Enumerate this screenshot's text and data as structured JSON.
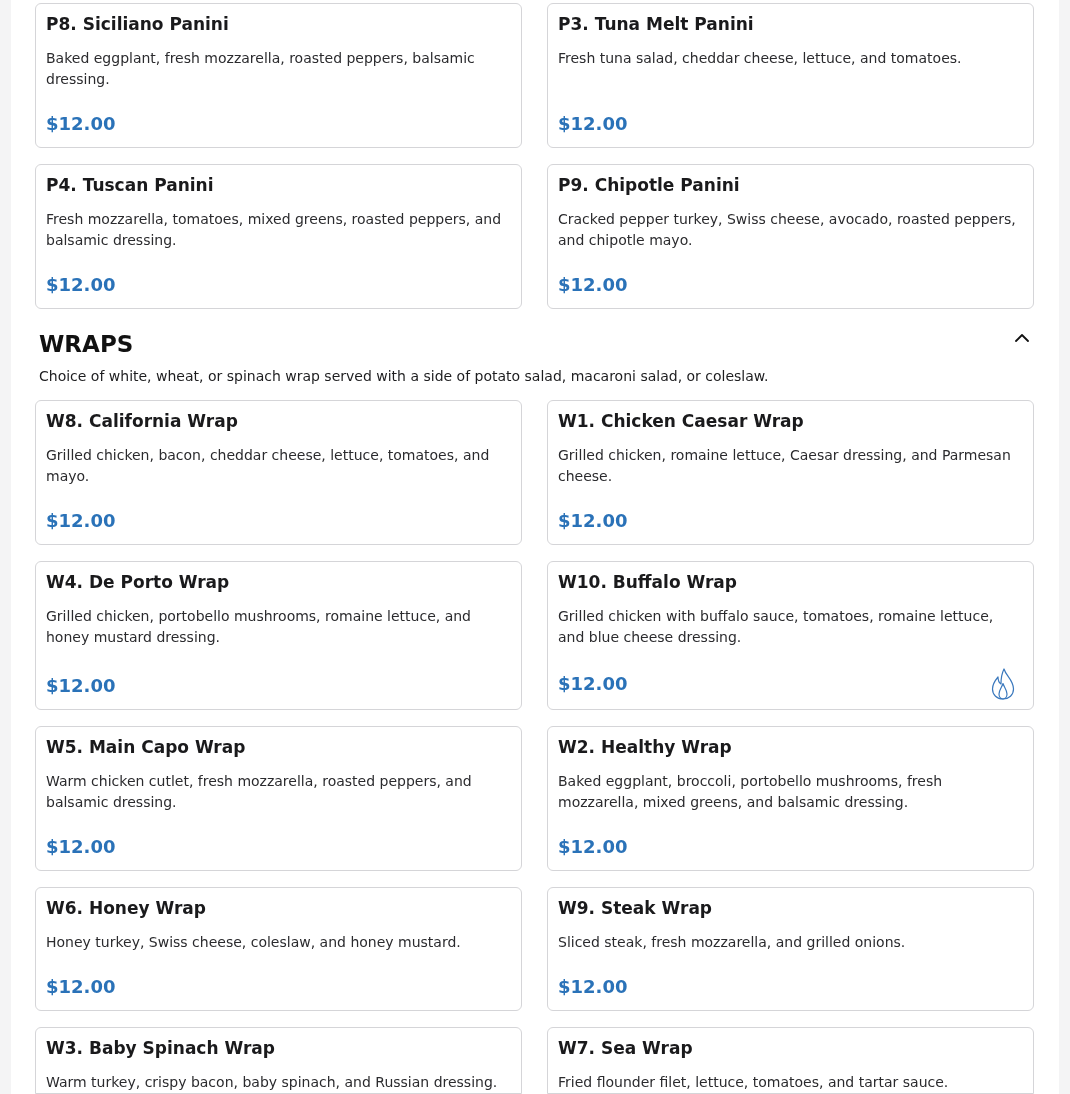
{
  "sections": [
    {
      "items": [
        {
          "title": "P8. Siciliano Panini",
          "description": "Baked eggplant, fresh mozzarella, roasted peppers, balsamic dressing.",
          "price": "$12.00",
          "spicy": false
        },
        {
          "title": "P3. Tuna Melt Panini",
          "description": "Fresh tuna salad, cheddar cheese, lettuce, and tomatoes.",
          "price": "$12.00",
          "spicy": false
        },
        {
          "title": "P4. Tuscan Panini",
          "description": "Fresh mozzarella, tomatoes, mixed greens, roasted peppers, and balsamic dressing.",
          "price": "$12.00",
          "spicy": false
        },
        {
          "title": "P9. Chipotle Panini",
          "description": "Cracked pepper turkey, Swiss cheese, avocado, roasted peppers, and chipotle mayo.",
          "price": "$12.00",
          "spicy": false
        }
      ]
    },
    {
      "title": "WRAPS",
      "expanded": true,
      "description": "Choice of white, wheat, or spinach wrap served with a side of potato salad, macaroni salad, or coleslaw.",
      "items": [
        {
          "title": "W8. California Wrap",
          "description": "Grilled chicken, bacon, cheddar cheese, lettuce, tomatoes, and mayo.",
          "price": "$12.00",
          "spicy": false
        },
        {
          "title": "W1. Chicken Caesar Wrap",
          "description": "Grilled chicken, romaine lettuce, Caesar dressing, and Parmesan cheese.",
          "price": "$12.00",
          "spicy": false
        },
        {
          "title": "W4. De Porto Wrap",
          "description": "Grilled chicken, portobello mushrooms, romaine lettuce, and honey mustard dressing.",
          "price": "$12.00",
          "spicy": false
        },
        {
          "title": "W10. Buffalo Wrap",
          "description": "Grilled chicken with buffalo sauce, tomatoes, romaine lettuce, and blue cheese dressing.",
          "price": "$12.00",
          "spicy": true
        },
        {
          "title": "W5. Main Capo Wrap",
          "description": "Warm chicken cutlet, fresh mozzarella, roasted peppers, and balsamic dressing.",
          "price": "$12.00",
          "spicy": false
        },
        {
          "title": "W2. Healthy Wrap",
          "description": "Baked eggplant, broccoli, portobello mushrooms, fresh mozzarella, mixed greens, and balsamic dressing.",
          "price": "$12.00",
          "spicy": false
        },
        {
          "title": "W6. Honey Wrap",
          "description": "Honey turkey, Swiss cheese, coleslaw, and honey mustard.",
          "price": "$12.00",
          "spicy": false
        },
        {
          "title": "W9. Steak Wrap",
          "description": "Sliced steak, fresh mozzarella, and grilled onions.",
          "price": "$12.00",
          "spicy": false
        },
        {
          "title": "W3. Baby Spinach Wrap",
          "description": "Warm turkey, crispy bacon, baby spinach, and Russian dressing."
        },
        {
          "title": "W7. Sea Wrap",
          "description": "Fried flounder filet, lettuce, tomatoes, and tartar sauce."
        }
      ]
    }
  ]
}
